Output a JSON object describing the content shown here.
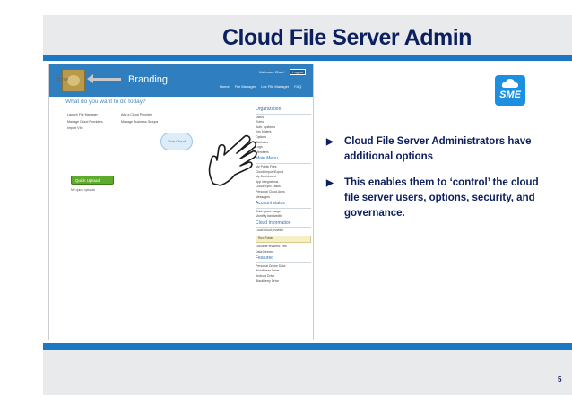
{
  "slide": {
    "title": "Cloud File Server Admin",
    "page_number": "5"
  },
  "logo": {
    "text": "SME"
  },
  "bullets": [
    "Cloud File Server Administrators have additional options",
    "This enables them to ‘control’ the cloud file server users, options, security, and governance."
  ],
  "screenshot": {
    "branding_label": "Branding",
    "welcome_text": "Welcome Ellen!",
    "logout_label": "Logout",
    "nav": [
      "Home",
      "File Manager",
      "Lite File Manager",
      "FAQ"
    ],
    "home_label": "Home",
    "question": "What do you want to do today?",
    "links_left": [
      "Launch File Manager",
      "Manage Cloud Providers",
      "Import Vfdi"
    ],
    "links_right": [
      "Add a Cloud Provider",
      "Manage Business Groups"
    ],
    "cloud_badge": "Your Cloud",
    "quick_upload": "Quick Upload",
    "quick_upload_sub": "My quick uploads",
    "sidebar": {
      "organization_header": "Organization",
      "organization_items": [
        "Users",
        "Roles",
        "Auth. systems",
        "Key folders",
        "Options",
        "Statistics",
        "Logs",
        "Members"
      ],
      "main_menu_header": "Main Menu",
      "main_menu_items": [
        "My Public Files",
        "Cloud Import/Export",
        "My Dashboard",
        "App integrations",
        "Cloud Sync Tasks",
        "Personal Cloud Apps",
        "Messages"
      ],
      "account_header": "Account status",
      "account_items": [
        "Total space usage",
        "Monthly bandwidth"
      ],
      "cloud_info_header": "Cloud Information",
      "cloud_info_items": [
        "Local cloud provider",
        "Root Folder",
        "Cloudfile enabled: Yes",
        "Data Director"
      ],
      "featured_header": "Featured",
      "featured_items": [
        "Personal Online Data",
        "WordPress Drive",
        "Android Drive",
        "BlackBerry Drive"
      ]
    }
  }
}
